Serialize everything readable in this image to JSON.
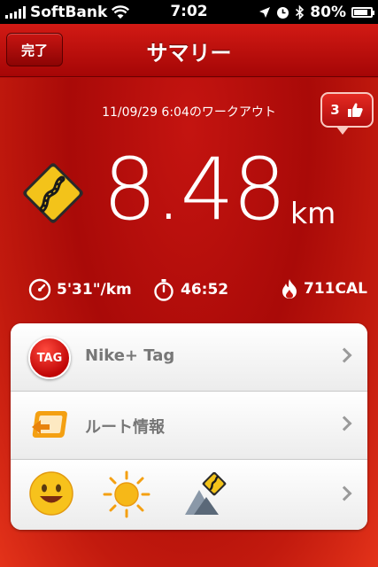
{
  "status_bar": {
    "carrier": "SoftBank",
    "time": "7:02",
    "battery": "80%"
  },
  "nav": {
    "done_label": "完了",
    "title": "サマリー"
  },
  "workout": {
    "date_label": "11/09/29 6:04のワークアウト",
    "likes": "3"
  },
  "distance": {
    "value": "8.48",
    "unit": "km"
  },
  "stats": {
    "pace": "5'31\"/km",
    "duration": "46:52",
    "calories": "711CAL"
  },
  "table": {
    "rows": [
      {
        "label": "Nike+ Tag",
        "icon_text": "TAG"
      },
      {
        "label": "ルート情報"
      },
      {
        "icons": [
          "smiley-icon",
          "sun-icon",
          "terrain-icon"
        ]
      }
    ]
  },
  "colors": {
    "background": "#b00c0c",
    "accent": "#d21a14",
    "card": "#ffffff"
  }
}
